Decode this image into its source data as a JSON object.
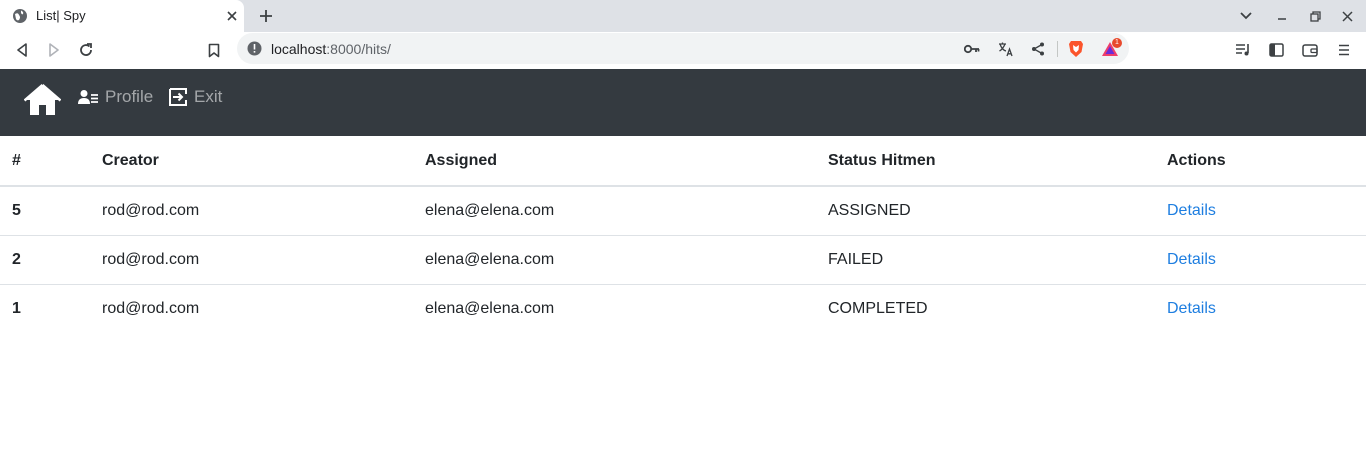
{
  "browser": {
    "tab_title": "List| Spy",
    "url_host": "localhost",
    "url_port": ":8000",
    "url_path": "/hits/",
    "extension_badge": "1"
  },
  "navbar": {
    "home_icon": "home-icon",
    "profile_label": "Profile",
    "exit_label": "Exit"
  },
  "table": {
    "headers": [
      "#",
      "Creator",
      "Assigned",
      "Status Hitmen",
      "Actions"
    ],
    "rows": [
      {
        "id": "5",
        "creator": "rod@rod.com",
        "assigned": "elena@elena.com",
        "status": "ASSIGNED",
        "action": "Details"
      },
      {
        "id": "2",
        "creator": "rod@rod.com",
        "assigned": "elena@elena.com",
        "status": "FAILED",
        "action": "Details"
      },
      {
        "id": "1",
        "creator": "rod@rod.com",
        "assigned": "elena@elena.com",
        "status": "COMPLETED",
        "action": "Details"
      }
    ]
  },
  "colors": {
    "navbar_bg": "#343a40",
    "link": "#1e7ee0",
    "tabstrip_bg": "#dee1e6"
  }
}
